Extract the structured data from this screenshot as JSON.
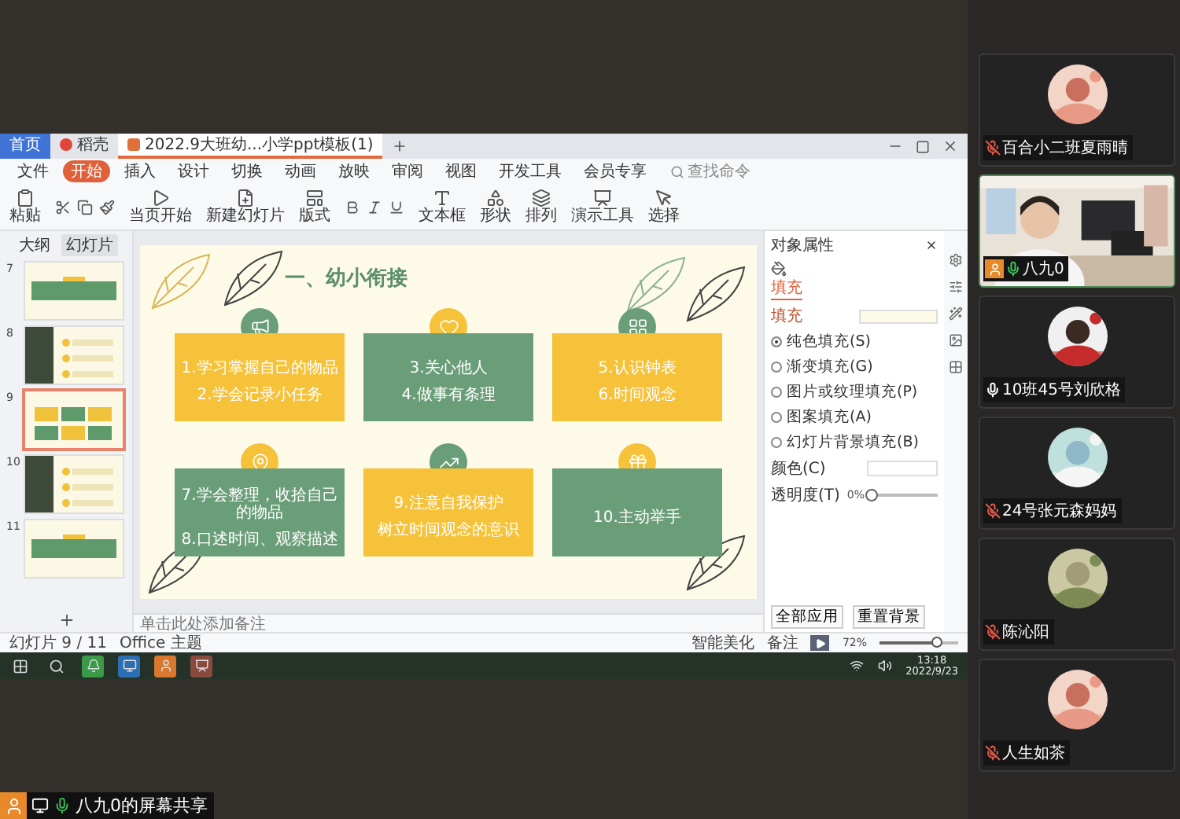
{
  "wps": {
    "tabs": [
      {
        "label": "首页",
        "kind": "home",
        "selected": false
      },
      {
        "label": "稻壳",
        "kind": "docer",
        "selected": false
      },
      {
        "label": "2022.9大班幼...小学ppt模板(1)",
        "kind": "file",
        "selected": true
      }
    ],
    "menu": [
      {
        "label": "文件",
        "selected": false
      },
      {
        "label": "开始",
        "selected": true
      },
      {
        "label": "插入",
        "selected": false
      },
      {
        "label": "设计",
        "selected": false
      },
      {
        "label": "切换",
        "selected": false
      },
      {
        "label": "动画",
        "selected": false
      },
      {
        "label": "放映",
        "selected": false
      },
      {
        "label": "审阅",
        "selected": false
      },
      {
        "label": "视图",
        "selected": false
      },
      {
        "label": "开发工具",
        "selected": false
      },
      {
        "label": "会员专享",
        "selected": false
      }
    ],
    "search": {
      "placeholder": "查找命令"
    },
    "ribbon": [
      {
        "label": "粘贴"
      },
      {
        "label": "当页开始"
      },
      {
        "label": "新建幻灯片"
      },
      {
        "label": "版式"
      },
      {
        "label": "文本框"
      },
      {
        "label": "形状"
      },
      {
        "label": "排列"
      },
      {
        "label": "演示工具"
      },
      {
        "label": "选择"
      }
    ],
    "panel_tabs": [
      {
        "label": "大纲",
        "selected": false
      },
      {
        "label": "幻灯片",
        "selected": true
      }
    ],
    "thumbnails": [
      {
        "number": "7",
        "kind": "title",
        "selected": false
      },
      {
        "number": "8",
        "selected": false
      },
      {
        "number": "9",
        "kind": "cards",
        "selected": true
      },
      {
        "number": "10",
        "selected": false
      },
      {
        "number": "11",
        "kind": "title",
        "selected": false
      }
    ],
    "notes": {
      "placeholder": "单击此处添加备注"
    },
    "status": {
      "slide": "幻灯片 9 / 11",
      "theme": "Office 主题",
      "beautify": "智能美化",
      "notes": "备注",
      "zoom": "72%",
      "level": 0.72
    }
  },
  "slide": {
    "title": "一、幼小衔接",
    "cards": [
      {
        "color": "#f5c23a",
        "lines": [
          "1.学习掌握自己的物品",
          "2.学会记录小任务"
        ]
      },
      {
        "color": "#6a9e78",
        "lines": [
          "3.关心他人",
          "4.做事有条理"
        ]
      },
      {
        "color": "#f5c23a",
        "lines": [
          "5.认识钟表",
          "6.时间观念"
        ]
      },
      {
        "color": "#6a9e78",
        "lines": [
          "7.学会整理，收拾自己的物品",
          "8.口述时间、观察描述"
        ]
      },
      {
        "color": "#f5c23a",
        "lines": [
          "9.注意自我保护",
          "树立时间观念的意识"
        ]
      },
      {
        "color": "#6a9e78",
        "lines": [
          "10.主动举手"
        ]
      }
    ]
  },
  "pane": {
    "title": "对象属性",
    "tab": "填充",
    "section": "填充",
    "fill_options": [
      {
        "label": "纯色填充(S)",
        "selected": true
      },
      {
        "label": "渐变填充(G)",
        "selected": false
      },
      {
        "label": "图片或纹理填充(P)",
        "selected": false
      },
      {
        "label": "图案填充(A)",
        "selected": false
      },
      {
        "label": "幻灯片背景填充(B)",
        "selected": false
      }
    ],
    "color_label": "颜色(C)",
    "transparency_label": "透明度(T)",
    "transparency": "0%",
    "level": 0,
    "buttons": [
      "全部应用",
      "重置背景"
    ]
  },
  "taskbar": {
    "time": "13:18",
    "date": "2022/9/23"
  },
  "meeting": {
    "participants": [
      {
        "name": "百合小二班夏雨晴",
        "muted": true,
        "speaking": false,
        "video": false,
        "selected": false
      },
      {
        "name": "八九0",
        "muted": false,
        "speaking": true,
        "video": true,
        "selected": true
      },
      {
        "name": "10班45号刘欣格",
        "muted": false,
        "speaking": false,
        "video": false,
        "selected": false
      },
      {
        "name": "24号张元森妈妈",
        "muted": true,
        "speaking": false,
        "video": false,
        "selected": false
      },
      {
        "name": "陈沁阳",
        "muted": true,
        "speaking": false,
        "video": false,
        "selected": false
      },
      {
        "name": "人生如茶",
        "muted": true,
        "speaking": false,
        "video": false,
        "selected": false
      }
    ],
    "share_label": "八九0的屏幕共享"
  }
}
